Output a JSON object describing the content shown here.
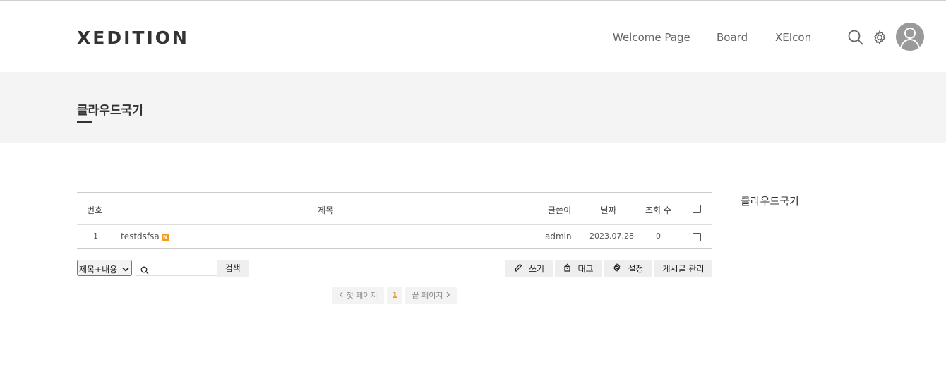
{
  "header": {
    "logo": "XEDITION",
    "nav": [
      "Welcome Page",
      "Board",
      "XEIcon"
    ],
    "icons": [
      "search-icon",
      "gear-icon",
      "user-avatar"
    ]
  },
  "banner": {
    "title": "클라우드국기"
  },
  "table": {
    "headers": {
      "no": "번호",
      "title": "제목",
      "author": "글쓴이",
      "date": "날짜",
      "views": "조회 수"
    },
    "rows": [
      {
        "no": "1",
        "title": "testdsfsa",
        "new_badge": "N",
        "author": "admin",
        "date": "2023.07.28",
        "views": "0"
      }
    ]
  },
  "search": {
    "select_value": "제목+내용",
    "input_value": "",
    "button": "검색"
  },
  "actions": {
    "write": "쓰기",
    "tag": "태그",
    "settings": "설정",
    "manage": "게시글 관리"
  },
  "pagination": {
    "first": "첫 페이지",
    "current": "1",
    "last": "끝 페이지"
  },
  "sidebar": {
    "title": "클라우드국기"
  },
  "colors": {
    "accent": "#e39a2b",
    "new_badge": "#f19b1c",
    "banner_bg": "#f4f4f4"
  }
}
